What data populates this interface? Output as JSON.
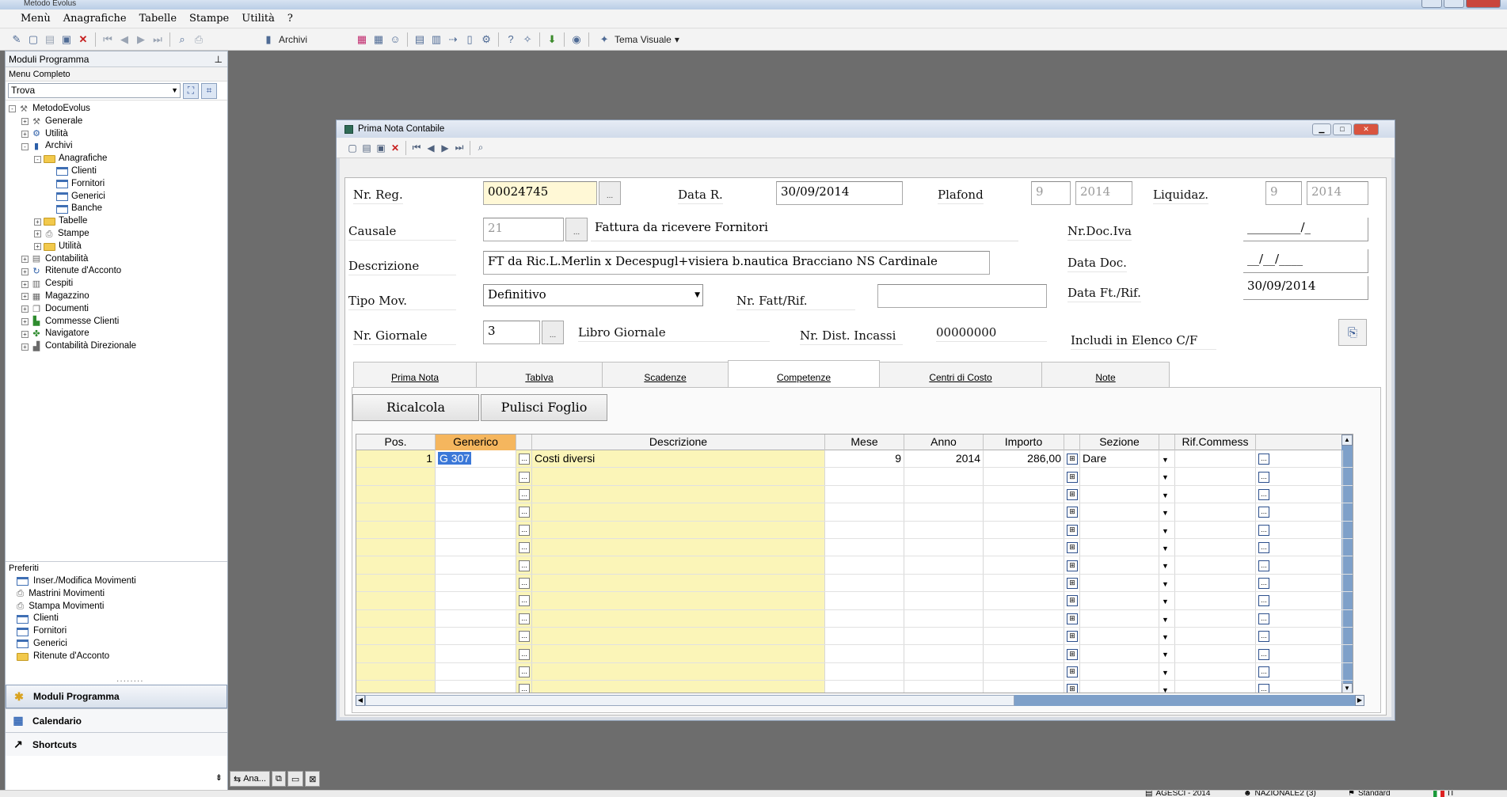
{
  "app": {
    "title": "Metodo Evolus"
  },
  "menu": [
    "Menù",
    "Anagrafiche",
    "Tabelle",
    "Stampe",
    "Utilità",
    "?"
  ],
  "toolbar": {
    "archivi_label": "Archivi",
    "tema_label": "Tema Visuale"
  },
  "left_panel": {
    "header": "Moduli Programma",
    "subheader": "Menu Completo",
    "find_value": "Trova",
    "tree": [
      {
        "label": "MetodoEvolus",
        "level": 0,
        "exp": "-",
        "icon": "tools-icon"
      },
      {
        "label": "Generale",
        "level": 1,
        "exp": "+",
        "icon": "tools-icon"
      },
      {
        "label": "Utilità",
        "level": 1,
        "exp": "+",
        "icon": "utility-icon"
      },
      {
        "label": "Archivi",
        "level": 1,
        "exp": "-",
        "icon": "archive-icon"
      },
      {
        "label": "Anagrafiche",
        "level": 2,
        "exp": "-",
        "icon": "folder-icon"
      },
      {
        "label": "Clienti",
        "level": 3,
        "exp": "",
        "icon": "form-icon"
      },
      {
        "label": "Fornitori",
        "level": 3,
        "exp": "",
        "icon": "form-icon"
      },
      {
        "label": "Generici",
        "level": 3,
        "exp": "",
        "icon": "form-icon"
      },
      {
        "label": "Banche",
        "level": 3,
        "exp": "",
        "icon": "form-icon"
      },
      {
        "label": "Tabelle",
        "level": 2,
        "exp": "+",
        "icon": "folder-icon"
      },
      {
        "label": "Stampe",
        "level": 2,
        "exp": "+",
        "icon": "printer-icon"
      },
      {
        "label": "Utilità",
        "level": 2,
        "exp": "+",
        "icon": "folder-icon"
      },
      {
        "label": "Contabilità",
        "level": 1,
        "exp": "+",
        "icon": "ledger-icon"
      },
      {
        "label": "Ritenute d'Acconto",
        "level": 1,
        "exp": "+",
        "icon": "withholding-icon"
      },
      {
        "label": "Cespiti",
        "level": 1,
        "exp": "+",
        "icon": "assets-icon"
      },
      {
        "label": "Magazzino",
        "level": 1,
        "exp": "+",
        "icon": "warehouse-icon"
      },
      {
        "label": "Documenti",
        "level": 1,
        "exp": "+",
        "icon": "documents-icon"
      },
      {
        "label": "Commesse Clienti",
        "level": 1,
        "exp": "+",
        "icon": "orders-icon"
      },
      {
        "label": "Navigatore",
        "level": 1,
        "exp": "+",
        "icon": "navigator-icon"
      },
      {
        "label": "Contabilità Direzionale",
        "level": 1,
        "exp": "+",
        "icon": "chart-icon"
      }
    ],
    "preferiti_header": "Preferiti",
    "preferiti": [
      {
        "label": "Inser./Modifica Movimenti",
        "icon": "form-icon"
      },
      {
        "label": "Mastrini Movimenti",
        "icon": "printer-icon"
      },
      {
        "label": "Stampa Movimenti",
        "icon": "printer-icon"
      },
      {
        "label": "Clienti",
        "icon": "form-icon"
      },
      {
        "label": "Fornitori",
        "icon": "form-icon"
      },
      {
        "label": "Generici",
        "icon": "form-icon"
      },
      {
        "label": "Ritenute d'Acconto",
        "icon": "folder-icon"
      }
    ],
    "nav_buttons": [
      "Moduli Programma",
      "Calendario",
      "Shortcuts"
    ]
  },
  "taskbar": {
    "item": "Ana..."
  },
  "status": {
    "company": "AGESCI - 2014",
    "user": "NAZIONALE2 (3)",
    "profile": "Standard",
    "lang": "IT"
  },
  "window": {
    "title": "Prima Nota Contabile",
    "fields": {
      "nr_reg_label": "Nr. Reg.",
      "nr_reg": "00024745",
      "data_r_label": "Data R.",
      "data_r": "30/09/2014",
      "plafond_label": "Plafond",
      "plafond_m": "9",
      "plafond_y": "2014",
      "liquidaz_label": "Liquidaz.",
      "liquidaz_m": "9",
      "liquidaz_y": "2014",
      "causale_label": "Causale",
      "causale_code": "21",
      "causale_desc": "Fattura da ricevere Fornitori",
      "nr_doc_iva_label": "Nr.Doc.Iva",
      "nr_doc_iva": "_________/_",
      "descrizione_label": "Descrizione",
      "descrizione": "FT da Ric.L.Merlin x Decespugl+visiera b.nautica Bracciano NS Cardinale",
      "data_doc_label": "Data Doc.",
      "data_doc": "__/__/____",
      "tipo_mov_label": "Tipo Mov.",
      "tipo_mov": "Definitivo",
      "nr_fatt_label": "Nr. Fatt/Rif.",
      "nr_fatt": "",
      "data_ft_label": "Data Ft./Rif.",
      "data_ft": "30/09/2014",
      "nr_giornale_label": "Nr. Giornale",
      "nr_giornale": "3",
      "libro_giornale_label": "Libro Giornale",
      "nr_dist_label": "Nr. Dist. Incassi",
      "nr_dist": "00000000",
      "includi_label": "Includi in Elenco C/F"
    },
    "tabs": [
      {
        "label": "Prima Nota",
        "active": false
      },
      {
        "label": "TabIva",
        "active": false
      },
      {
        "label": "Scadenze",
        "active": false
      },
      {
        "label": "Competenze",
        "active": true
      },
      {
        "label": "Centri di Costo",
        "active": false
      },
      {
        "label": "Note",
        "active": false
      }
    ],
    "buttons": {
      "ricalcola": "Ricalcola",
      "pulisci": "Pulisci Foglio"
    },
    "grid": {
      "columns": [
        "Pos.",
        "Generico",
        "",
        "Descrizione",
        "Mese",
        "Anno",
        "Importo",
        "",
        "Sezione",
        "",
        "Rif.Commess",
        ""
      ],
      "rows": [
        {
          "pos": "1",
          "generico": "G  307",
          "descrizione": "Costi diversi",
          "mese": "9",
          "anno": "2014",
          "importo": "286,00",
          "sezione": "Dare"
        }
      ],
      "empty_rows": 13
    }
  }
}
